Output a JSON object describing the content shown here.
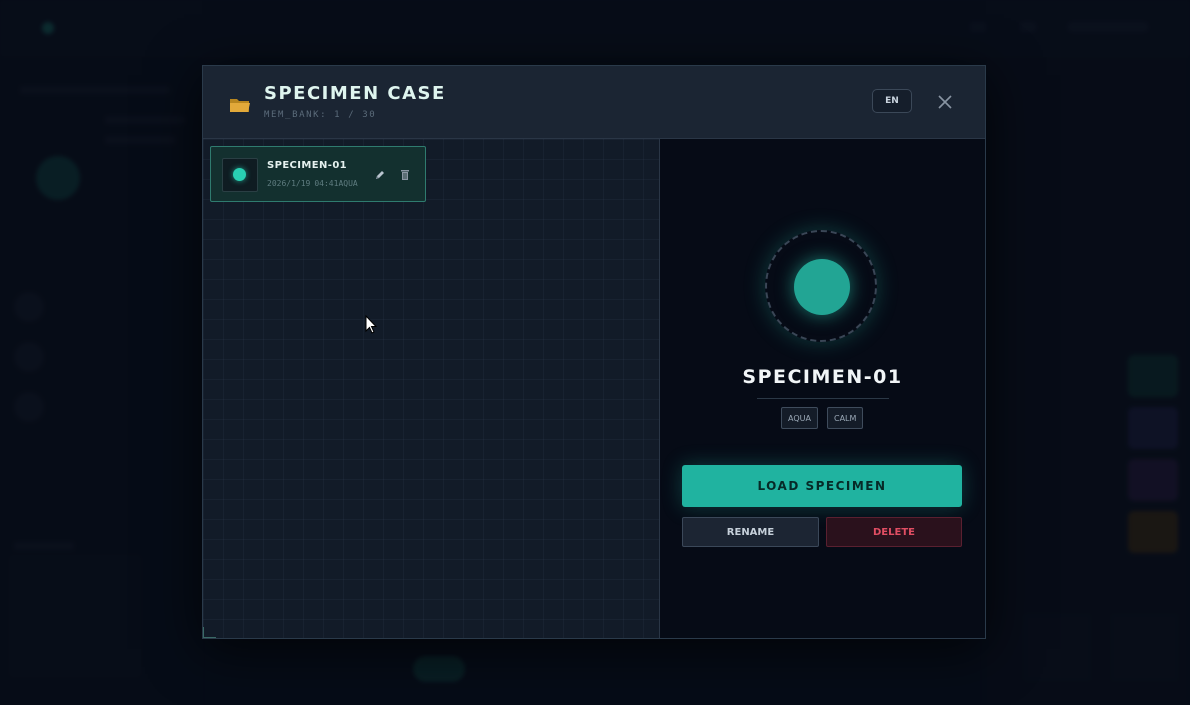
{
  "modal": {
    "title": "SPECIMEN CASE",
    "subtitle": "MEM_BANK: 1 / 30",
    "language_label": "EN",
    "icons": {
      "folder": "folder-icon",
      "close": "close-icon",
      "edit": "pencil-icon",
      "delete": "trash-icon"
    }
  },
  "list": {
    "items": [
      {
        "name": "SPECIMEN-01",
        "date": "2026/1/19",
        "time": "04:41",
        "tag": "AQUA",
        "color": "#29d0b3"
      }
    ]
  },
  "detail": {
    "name": "SPECIMEN-01",
    "tags": [
      "AQUA",
      "CALM"
    ],
    "load_label": "LOAD SPECIMEN",
    "rename_label": "RENAME",
    "delete_label": "DELETE",
    "accent_color": "#20b3a0"
  },
  "colors": {
    "accent": "#20b3a0",
    "danger": "#e04e63",
    "background": "#0b1220"
  }
}
